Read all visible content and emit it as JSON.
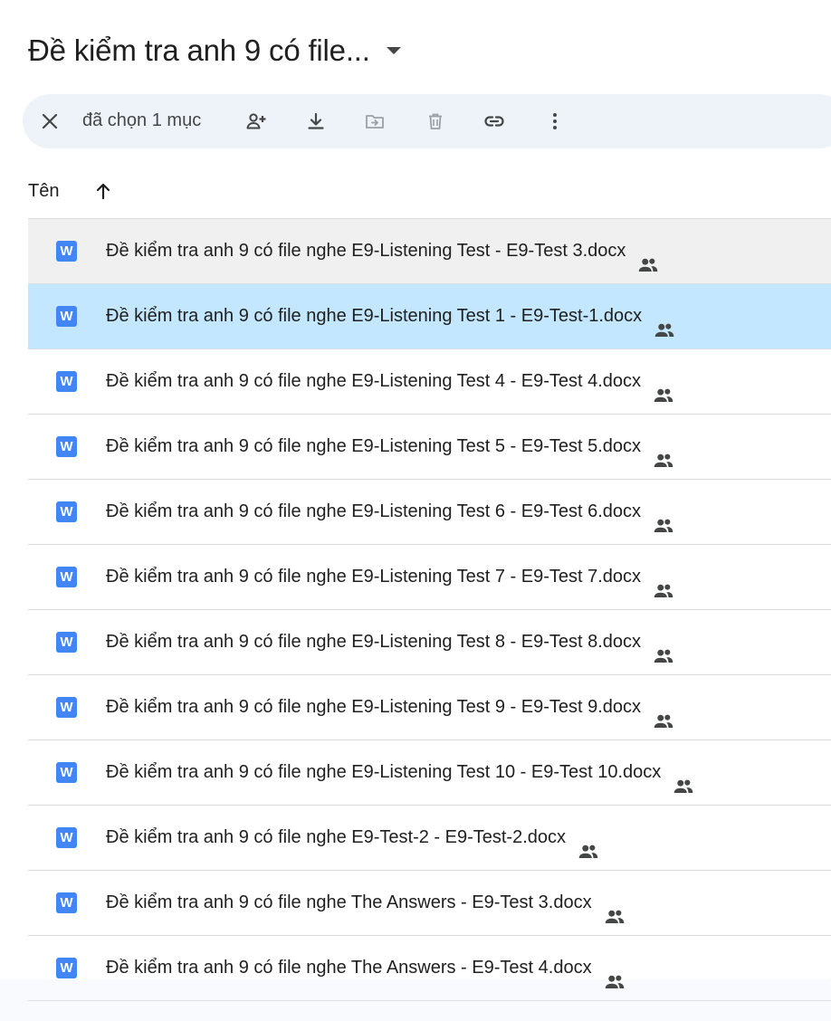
{
  "header": {
    "title": "Đề kiểm tra anh 9 có file...",
    "title_dropdown_icon": "caret-down-icon"
  },
  "toolbar": {
    "selection_text": "đã chọn 1 mục",
    "icons": [
      "close-icon",
      "share-person-icon",
      "download-icon",
      "move-folder-icon",
      "trash-icon",
      "link-icon",
      "more-vert-icon"
    ]
  },
  "columns": {
    "name_label": "Tên",
    "sort_icon": "arrow-up-icon"
  },
  "files": [
    {
      "name": "Đề kiểm tra anh 9 có file nghe E9-Listening Test - E9-Test 3.docx",
      "state": "hover"
    },
    {
      "name": "Đề kiểm tra anh 9 có file nghe E9-Listening Test 1 - E9-Test-1.docx",
      "state": "selected"
    },
    {
      "name": "Đề kiểm tra anh 9 có file nghe E9-Listening Test 4 - E9-Test 4.docx",
      "state": "normal"
    },
    {
      "name": "Đề kiểm tra anh 9 có file nghe E9-Listening Test 5 - E9-Test 5.docx",
      "state": "normal"
    },
    {
      "name": "Đề kiểm tra anh 9 có file nghe E9-Listening Test 6 - E9-Test 6.docx",
      "state": "normal"
    },
    {
      "name": "Đề kiểm tra anh 9 có file nghe E9-Listening Test 7 - E9-Test 7.docx",
      "state": "normal"
    },
    {
      "name": "Đề kiểm tra anh 9 có file nghe E9-Listening Test 8 - E9-Test 8.docx",
      "state": "normal"
    },
    {
      "name": "Đề kiểm tra anh 9 có file nghe E9-Listening Test 9 - E9-Test 9.docx",
      "state": "normal"
    },
    {
      "name": "Đề kiểm tra anh 9 có file nghe E9-Listening Test 10 - E9-Test 10.docx",
      "state": "normal"
    },
    {
      "name": "Đề kiểm tra anh 9 có file nghe E9-Test-2 - E9-Test-2.docx",
      "state": "normal"
    },
    {
      "name": "Đề kiểm tra anh 9 có file nghe The Answers - E9-Test 3.docx",
      "state": "normal"
    },
    {
      "name": "Đề kiểm tra anh 9 có file nghe The Answers - E9-Test 4.docx",
      "state": "normal"
    }
  ],
  "file_icon_letter": "W",
  "colors": {
    "accent": "#4285f4",
    "selected_row": "#c2e7ff",
    "hover_row": "#f0f0f0",
    "toolbar_bg": "#eef2f9"
  }
}
